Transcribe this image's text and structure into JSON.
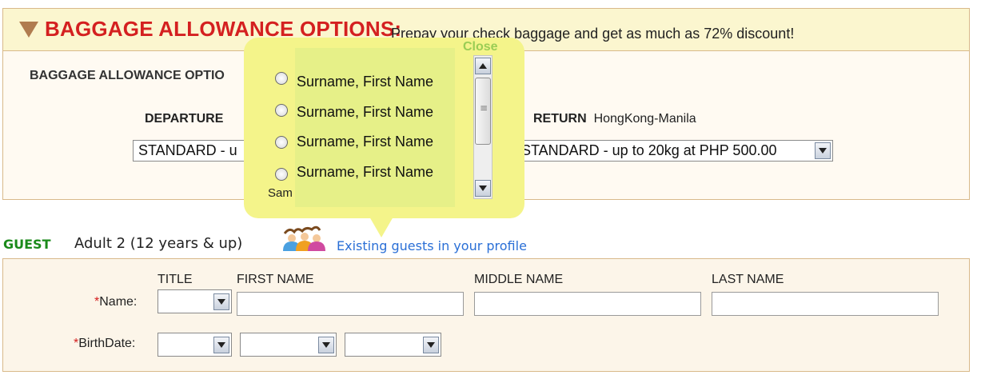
{
  "baggage": {
    "title": "BAGGAGE ALLOWANCE OPTIONS:",
    "subtitle": "Prepay your check baggage and get as much as 72% discount!",
    "options_label": "BAGGAGE ALLOWANCE OPTIO",
    "departure": {
      "label": "DEPARTURE",
      "selected": "STANDARD - u"
    },
    "return": {
      "label": "RETURN",
      "route": "HongKong-Manila",
      "selected": "STANDARD - up to 20kg at PHP 500.00"
    }
  },
  "popup": {
    "close_label": "Close",
    "names": [
      "Surname, First Name",
      "Surname, First Name",
      "Surname, First Name",
      "Surname, First Name"
    ],
    "cut_text": "Sam"
  },
  "guest": {
    "label": "GUEST",
    "type": "Adult 2 (12 years & up)",
    "existing_link": "Existing guests in your profile",
    "columns": {
      "title": "TITLE",
      "first_name": "FIRST NAME",
      "middle_name": "MIDDLE NAME",
      "last_name": "LAST NAME"
    },
    "required_mark": "*",
    "name_label": "Name:",
    "birthdate_label": "BirthDate:"
  },
  "colors": {
    "title_red": "#d42020",
    "guest_green": "#1a8a1a",
    "link_blue": "#2a6fd6",
    "popup_yellow": "#f4f48a",
    "close_green": "#9acd55"
  },
  "icons": {
    "header_arrow": "triangle-down-icon",
    "guests": "people-icon"
  }
}
